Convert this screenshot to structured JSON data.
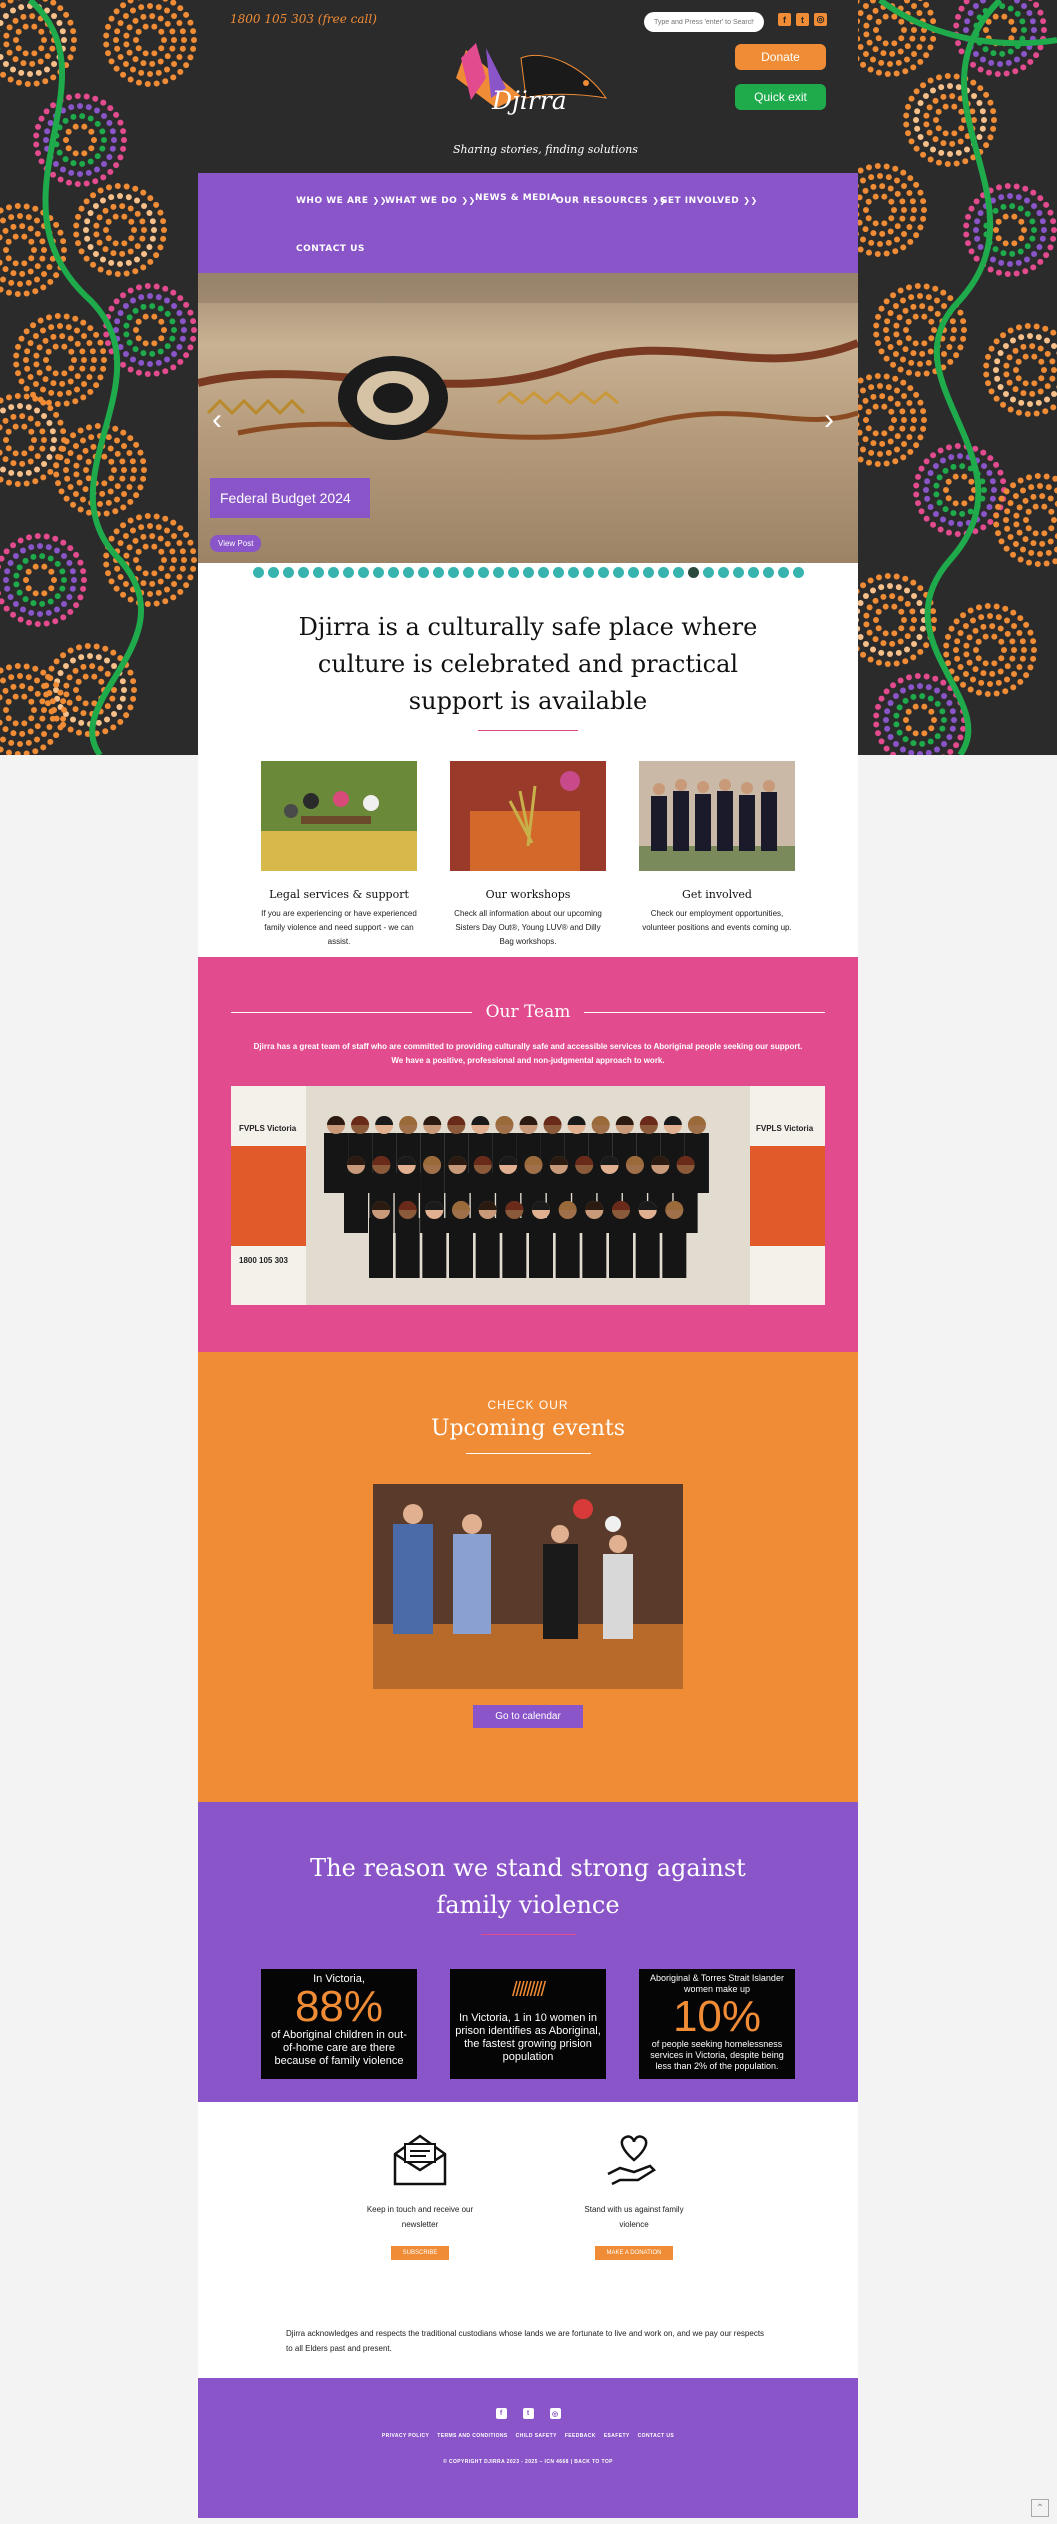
{
  "header": {
    "phone": "1800 105 303 (free call)",
    "search_placeholder": "Type and Press 'enter' to Search",
    "donate_label": "Donate",
    "quick_exit_label": "Quick exit",
    "logo_text": "Djirra",
    "tagline": "Sharing stories, finding solutions",
    "social_icons": [
      "facebook-icon",
      "twitter-icon",
      "instagram-icon"
    ]
  },
  "nav": {
    "items": [
      {
        "label": "WHO WE ARE",
        "dropdown": true
      },
      {
        "label": "WHAT WE DO",
        "dropdown": true
      },
      {
        "label": "NEWS & MEDIA",
        "dropdown": false
      },
      {
        "label": "OUR RESOURCES",
        "dropdown": true
      },
      {
        "label": "GET INVOLVED",
        "dropdown": true
      },
      {
        "label": "CONTACT US",
        "dropdown": false
      }
    ]
  },
  "slider": {
    "caption": "Federal Budget 2024",
    "view_post_label": "View Post",
    "dot_count": 37,
    "active_dot": 29
  },
  "intro": {
    "headline": "Djirra is a culturally safe place where culture is celebrated and practical support is available",
    "cards": [
      {
        "title": "Legal services & support",
        "text": "If you are experiencing or have experienced family violence and need support - we can assist."
      },
      {
        "title": "Our workshops",
        "text": "Check all information about our upcoming Sisters Day Out®, Young LUV® and Dilly Bag workshops."
      },
      {
        "title": "Get involved",
        "text": "Check our employment opportunities, volunteer positions and events coming up."
      }
    ]
  },
  "team": {
    "title": "Our Team",
    "text": "Djirra has a great team of staff who are committed to providing culturally safe and accessible services to Aboriginal people seeking our support. We have a positive, professional and non-judgmental approach to work.",
    "banner_left": "FVPLS Victoria",
    "banner_right": "FVPLS Victoria",
    "banner_phone": "1800 105 303"
  },
  "events": {
    "kicker": "CHECK OUR",
    "title": "Upcoming events",
    "button_label": "Go to calendar"
  },
  "stats": {
    "title": "The reason we stand strong against family violence",
    "cards": [
      {
        "top": "In Victoria,",
        "big": "88%",
        "bottom": "of Aboriginal children in out-of-home care are there because of family violence"
      },
      {
        "top": "",
        "big": "",
        "bottom": "In Victoria, 1 in 10 women in prison identifies as Aboriginal, the fastest growing prision population"
      },
      {
        "top": "Aboriginal & Torres Strait Islander women make up",
        "big": "10%",
        "bottom": "of people seeking homelessness services in Victoria, despite being less than 2% of the population."
      }
    ]
  },
  "cta": {
    "newsletter_text": "Keep in touch and receive our newsletter",
    "newsletter_button": "SUBSCRIBE",
    "donate_text": "Stand with us against family violence",
    "donate_button": "MAKE A DONATION",
    "acknowledgement": "Djirra acknowledges and respects the traditional custodians whose lands we are fortunate to live and work on, and we pay our respects to all Elders past and present."
  },
  "footer": {
    "links": [
      "PRIVACY POLICY",
      "TERMS AND CONDITIONS",
      "CHILD SAFETY",
      "FEEDBACK",
      "ESAFETY",
      "CONTACT US"
    ],
    "copyright": "© COPYRIGHT DJIRRA 2023 - 2025 – ICN 4668 | BACK TO TOP"
  },
  "colors": {
    "purple": "#8a55c9",
    "pink": "#e24b8e",
    "orange": "#f08c35",
    "green": "#1faa4b",
    "teal": "#37b4ad"
  }
}
